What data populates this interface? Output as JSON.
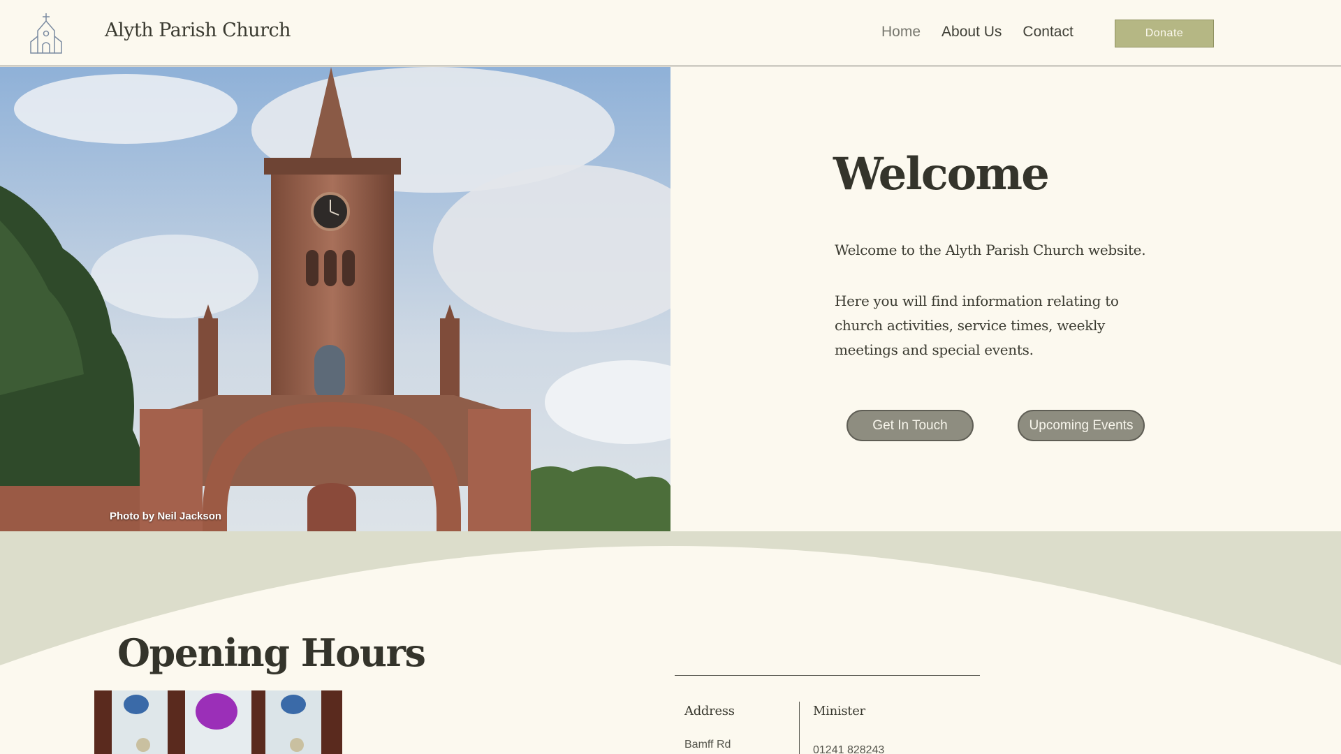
{
  "header": {
    "brand": "Alyth Parish Church",
    "nav": [
      {
        "label": "Home",
        "active": true
      },
      {
        "label": "About Us",
        "active": false
      },
      {
        "label": "Contact",
        "active": false
      }
    ],
    "donate_label": "Donate"
  },
  "hero": {
    "photo_credit": "Photo by Neil Jackson"
  },
  "welcome": {
    "title": "Welcome",
    "paragraph1": "Welcome to the Alyth Parish Church website.",
    "paragraph2": "Here you will find information relating to church activities, service times, weekly meetings and special events.",
    "button_get_in_touch": "Get In Touch",
    "button_upcoming_events": "Upcoming Events"
  },
  "opening": {
    "title": "Opening Hours"
  },
  "info": {
    "address_heading": "Address",
    "address_value": "Bamff Rd",
    "minister_heading": "Minister",
    "minister_value": "01241 828243"
  },
  "colors": {
    "background": "#fcf9ef",
    "accent": "#b5b784",
    "band": "#dcddcb",
    "pill": "#8e8d80"
  },
  "icons": {
    "logo": "church-icon"
  }
}
